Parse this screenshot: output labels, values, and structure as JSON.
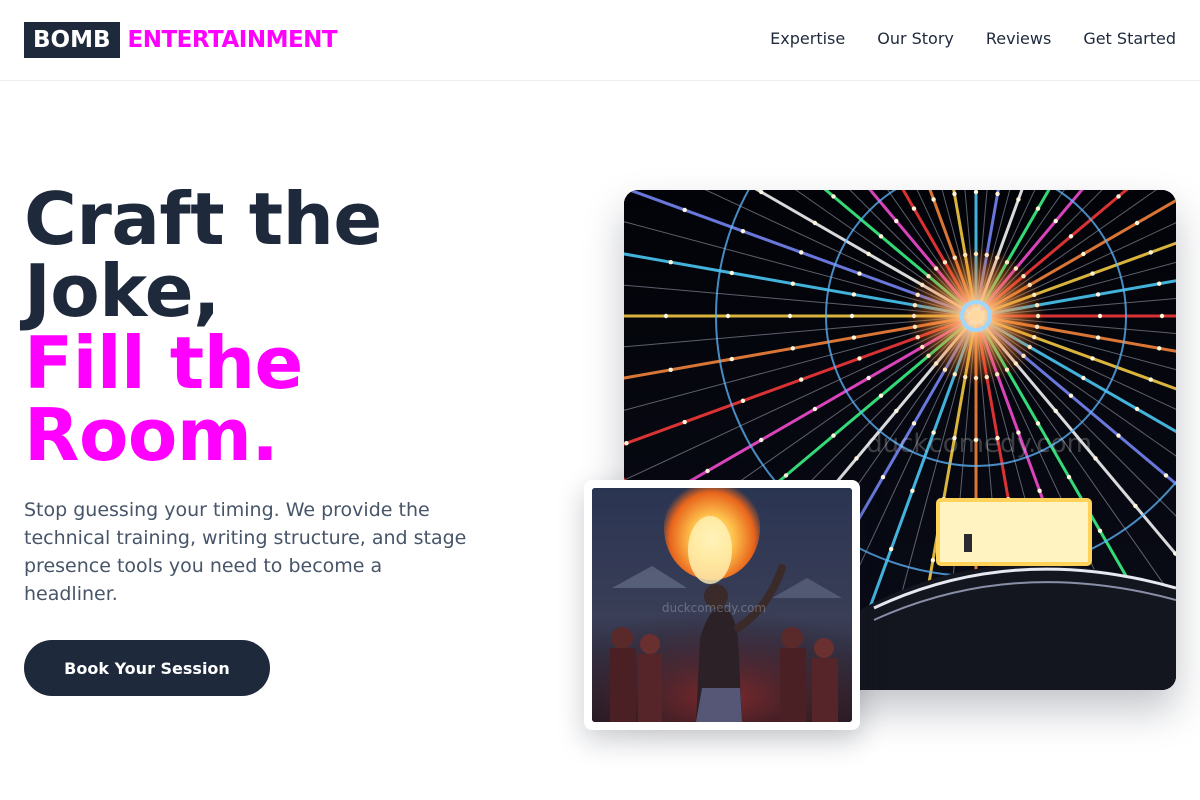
{
  "brand": {
    "box_text": "BOMB",
    "text": "ENTERTAINMENT",
    "accent_color": "#ff00ff",
    "dark_color": "#1e293b"
  },
  "nav": {
    "items": [
      {
        "label": "Expertise"
      },
      {
        "label": "Our Story"
      },
      {
        "label": "Reviews"
      },
      {
        "label": "Get Started"
      }
    ]
  },
  "hero": {
    "headline_line1": "Craft the",
    "headline_line2": "Joke,",
    "headline_line3": "Fill the",
    "headline_line4": "Room.",
    "subtext": "Stop guessing your timing. We provide the technical training, writing structure, and stage presence tools you need to become a headliner.",
    "cta_label": "Book Your Session"
  },
  "images": {
    "main_watermark": "duckcomedy.com",
    "inset_watermark": "duckcomedy.com"
  }
}
